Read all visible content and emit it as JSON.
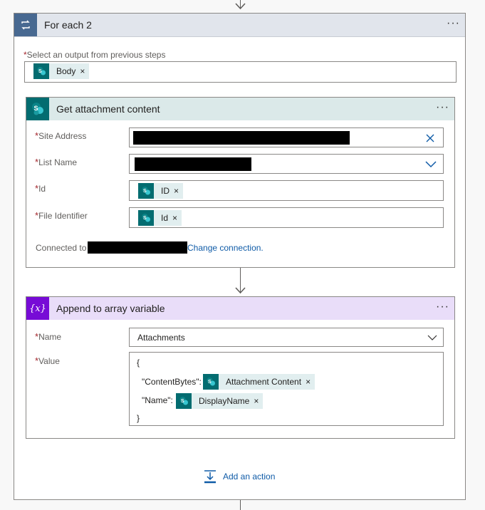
{
  "foreach": {
    "title": "For each 2",
    "menu": "···",
    "select_label": "Select an output from previous steps",
    "select_token": "Body"
  },
  "get_attachment": {
    "title": "Get attachment content",
    "menu": "···",
    "fields": {
      "site_address_label": "Site Address",
      "list_name_label": "List Name",
      "id_label": "Id",
      "id_token": "ID",
      "file_identifier_label": "File Identifier",
      "file_identifier_token": "Id"
    },
    "connected_to": "Connected to",
    "change_connection": "Change connection."
  },
  "append_variable": {
    "title": "Append to array variable",
    "icon_text": "{x}",
    "menu": "···",
    "name_label": "Name",
    "name_value": "Attachments",
    "value_label": "Value",
    "json_open": "{",
    "content_bytes_key": "\"ContentBytes\":",
    "content_bytes_token": "Attachment Content",
    "name_key": "\"Name\":",
    "name_token": "DisplayName",
    "json_close": "}"
  },
  "add_action": {
    "label": "Add an action"
  },
  "colors": {
    "foreach_accent": "#486991",
    "sharepoint": "#036c70",
    "variable_accent": "#770bd6",
    "link": "#0f5ba7"
  }
}
